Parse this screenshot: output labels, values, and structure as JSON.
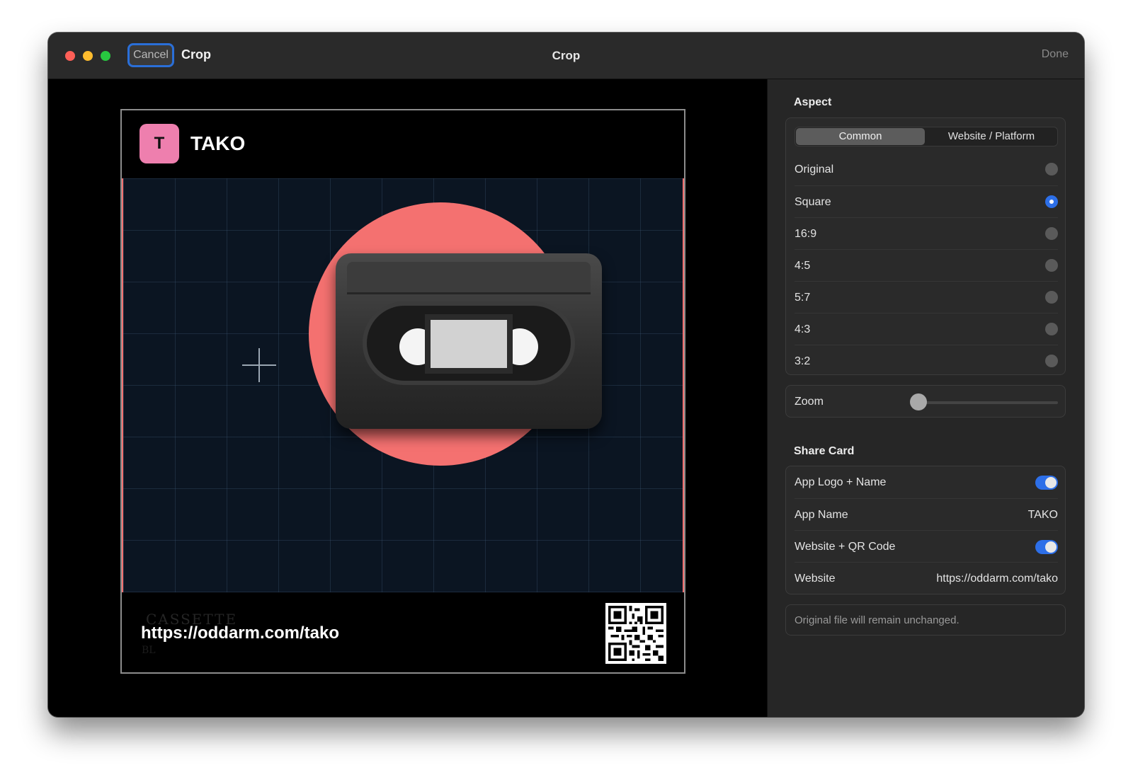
{
  "titlebar": {
    "cancel_label": "Cancel",
    "crop_label": "Crop",
    "window_title": "Crop",
    "done_label": "Done"
  },
  "card": {
    "logo_letter": "T",
    "app_name": "TAKO",
    "brand_text": "CASSETTE",
    "brand_text_2": "BL",
    "footer_url": "https://oddarm.com/tako"
  },
  "aspect": {
    "title": "Aspect",
    "tabs": [
      "Common",
      "Website / Platform"
    ],
    "options": [
      {
        "label": "Original",
        "selected": false
      },
      {
        "label": "Square",
        "selected": true
      },
      {
        "label": "16:9",
        "selected": false
      },
      {
        "label": "4:5",
        "selected": false
      },
      {
        "label": "5:7",
        "selected": false
      },
      {
        "label": "4:3",
        "selected": false
      },
      {
        "label": "3:2",
        "selected": false
      }
    ]
  },
  "zoom": {
    "label": "Zoom",
    "value": 0
  },
  "share_card": {
    "title": "Share Card",
    "logo_toggle_label": "App Logo + Name",
    "app_name_label": "App Name",
    "app_name_value": "TAKO",
    "website_toggle_label": "Website + QR Code",
    "website_label": "Website",
    "website_value": "https://oddarm.com/tako"
  },
  "note": "Original file will remain unchanged.",
  "colors": {
    "accent": "#2d6fe8",
    "logo_bg": "#ee7fae",
    "circle": "#f47170"
  }
}
